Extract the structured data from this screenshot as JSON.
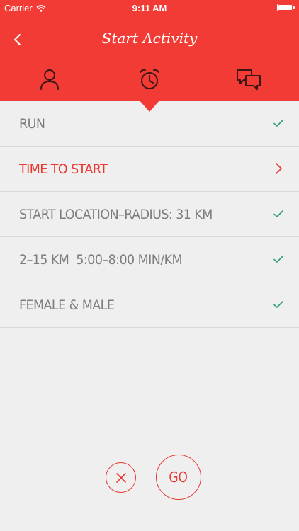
{
  "status_bar": {
    "carrier": "Carrier",
    "time": "9:11 AM",
    "icons": [
      "wifi-icon",
      "battery-icon"
    ]
  },
  "header": {
    "title": "Start Activity",
    "back_icon": "chevron-left-icon",
    "tabs": [
      {
        "icon": "person-icon",
        "selected": false
      },
      {
        "icon": "alarm-clock-icon",
        "selected": true
      },
      {
        "icon": "chat-bubbles-icon",
        "selected": false
      }
    ]
  },
  "settings": [
    {
      "label": "RUN",
      "state": "done",
      "icon": "checkmark-icon"
    },
    {
      "label": "TIME TO START",
      "state": "active",
      "icon": "chevron-right-icon"
    },
    {
      "label": "START LOCATION–RADIUS: 31 KM",
      "state": "done",
      "icon": "checkmark-icon"
    },
    {
      "label": "2–15 KM  5:00–8:00 MIN/KM",
      "state": "done",
      "icon": "checkmark-icon"
    },
    {
      "label": "FEMALE & MALE",
      "state": "done",
      "icon": "checkmark-icon"
    }
  ],
  "actions": {
    "cancel_icon": "close-icon",
    "go_label": "GO"
  },
  "colors": {
    "accent": "#f23b35",
    "active_text": "#e8382f",
    "check": "#2e9e6e",
    "muted_text": "#7d7d7d",
    "background": "#efefef"
  }
}
